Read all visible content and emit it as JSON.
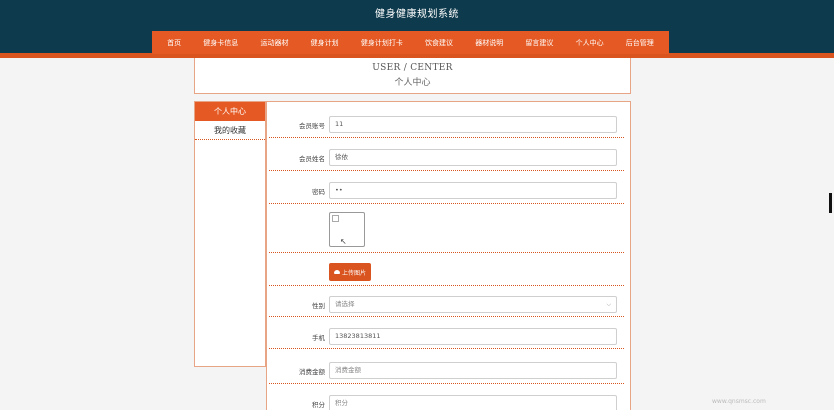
{
  "site_title": "健身健康规划系统",
  "nav": [
    "首页",
    "健身卡信息",
    "运动器材",
    "健身计划",
    "健身计划打卡",
    "饮食建议",
    "器材说明",
    "留言建议",
    "个人中心",
    "后台管理"
  ],
  "header": {
    "en": "USER / CENTER",
    "cn": "个人中心"
  },
  "sidebar": {
    "items": [
      "个人中心",
      "我的收藏"
    ]
  },
  "form": {
    "account_label": "会员账号",
    "account_value": "11",
    "name_label": "会员姓名",
    "name_value": "徐依",
    "password_label": "密码",
    "password_value": "••",
    "upload_label": "上传图片",
    "gender_label": "性别",
    "gender_value": "请选择",
    "phone_label": "手机",
    "phone_value": "13823813811",
    "consumption_label": "消费金额",
    "consumption_value": "消费金额",
    "points_label": "积分",
    "points_value": "积分"
  },
  "icons": {
    "upload": "cloud-upload-icon",
    "select": "chevron-down-icon"
  },
  "colors": {
    "topbar": "#0d3a4c",
    "accent": "#e55a24"
  },
  "watermark": "www.qnsmsc.com"
}
